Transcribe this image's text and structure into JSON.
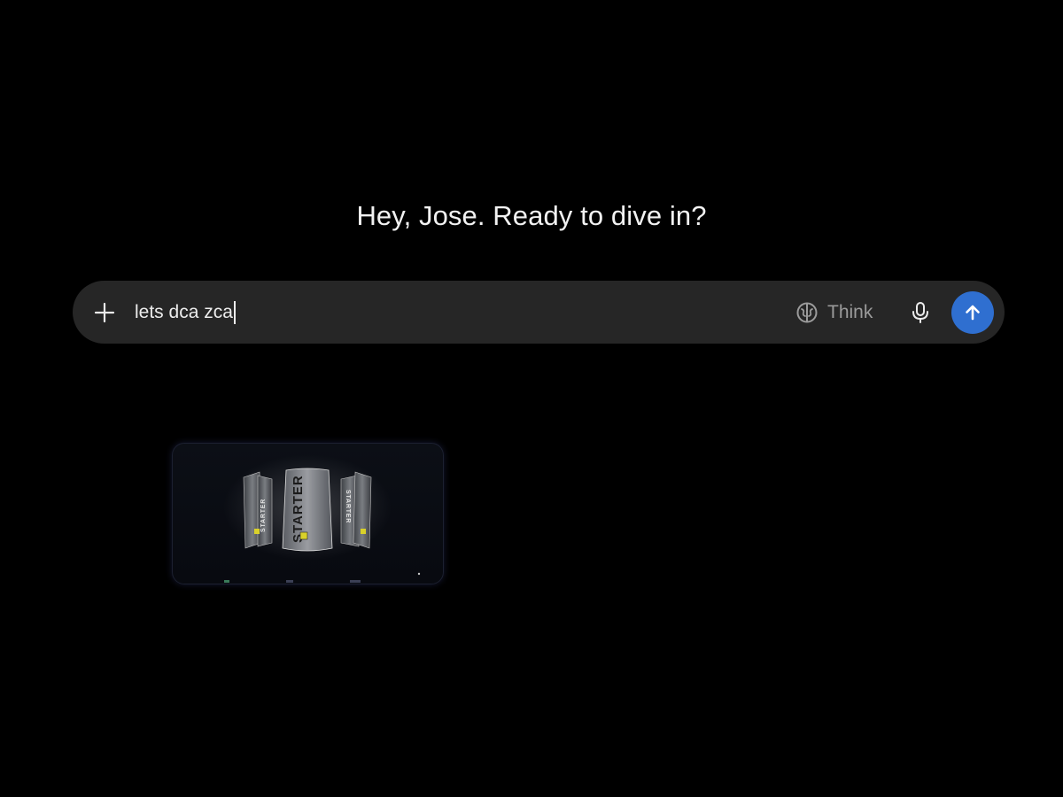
{
  "greeting": "Hey, Jose. Ready to dive in?",
  "composer": {
    "input_value": "lets dca zca",
    "think_label": "Think",
    "send_color": "#2f6fd0"
  },
  "attachment": {
    "bag_brand": "STARTER"
  }
}
